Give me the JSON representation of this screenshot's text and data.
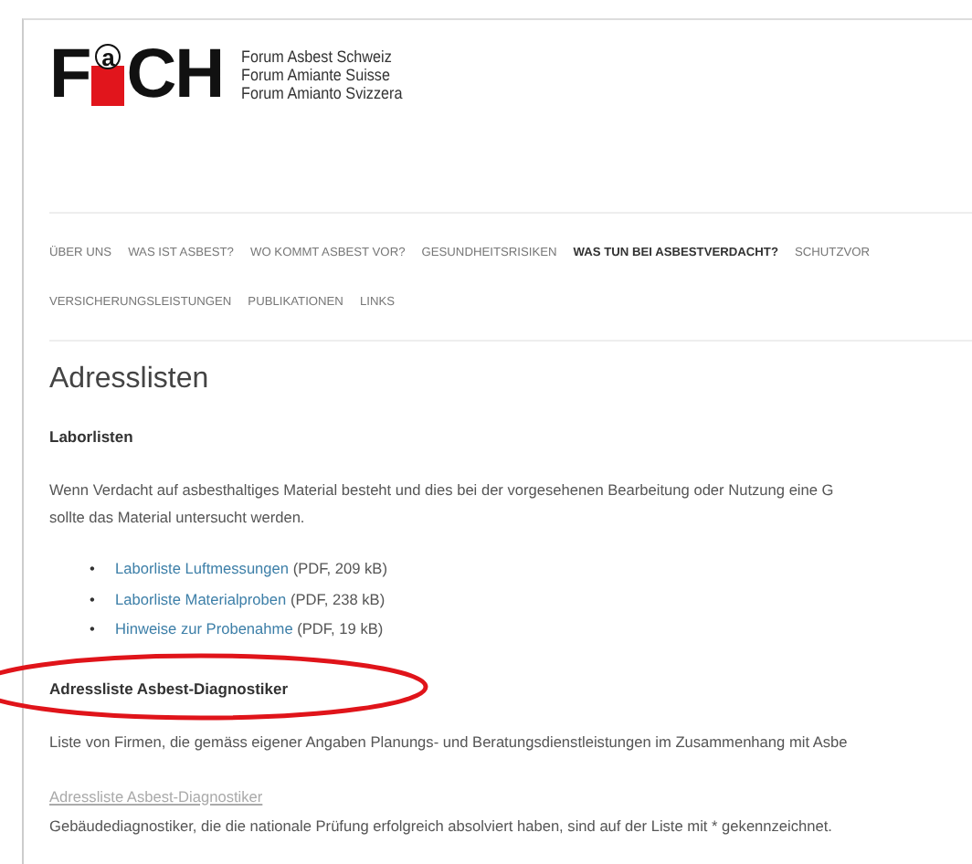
{
  "logo": {
    "letters": [
      "F",
      "a",
      "CH"
    ],
    "lines": [
      "Forum Asbest Schweiz",
      "Forum Amiante Suisse",
      "Forum Amianto Svizzera"
    ]
  },
  "nav_rows": [
    [
      {
        "label": "ÜBER UNS",
        "selected": false
      },
      {
        "label": "WAS IST ASBEST?",
        "selected": false
      },
      {
        "label": "WO KOMMT ASBEST VOR?",
        "selected": false
      },
      {
        "label": "GESUNDHEITSRISIKEN",
        "selected": false
      },
      {
        "label": "WAS TUN BEI ASBESTVERDACHT?",
        "selected": true
      },
      {
        "label": "SCHUTZVOR",
        "selected": false
      }
    ],
    [
      {
        "label": "VERSICHERUNGSLEISTUNGEN",
        "selected": false
      },
      {
        "label": "PUBLIKATIONEN",
        "selected": false
      },
      {
        "label": "LINKS",
        "selected": false
      }
    ]
  ],
  "content": {
    "title": "Adresslisten",
    "sections": [
      {
        "heading": "Laborlisten",
        "circled": false,
        "paragraph": [
          "Wenn Verdacht auf asbesthaltiges Material besteht und dies bei der vorgesehenen Bearbeitung oder Nutzung eine G",
          "sollte das Material untersucht werden."
        ],
        "links": [
          {
            "bullet": "•",
            "label": "Laborliste Luftmessungen",
            "meta": "(PDF, 209 kB)"
          },
          {
            "bullet": "•",
            "label": "Laborliste Materialproben",
            "meta": "(PDF, 238 kB)"
          },
          {
            "bullet": "•",
            "label": "Hinweise zur Probenahme",
            "meta": "(PDF, 19 kB)"
          }
        ]
      },
      {
        "heading": "Adressliste Asbest-Diagnostiker",
        "circled": true,
        "paragraph": [
          "Liste von Firmen, die gemäss eigener Angaben Planungs- und Beratungsdienstleistungen im Zusammenhang mit Asbe"
        ],
        "plain_link": "Adressliste Asbest-Diagnostiker",
        "note": "Gebäudediagnostiker, die die nationale Prüfung erfolgreich absolviert haben, sind auf der Liste mit * gekennzeichnet."
      }
    ]
  }
}
